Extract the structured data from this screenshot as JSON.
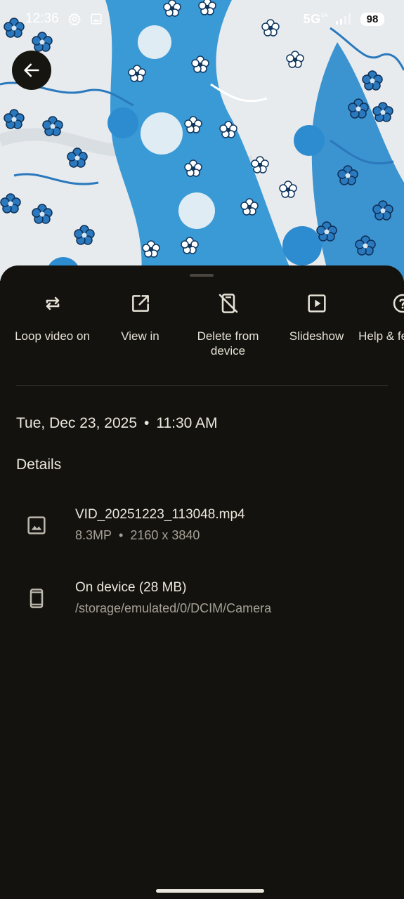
{
  "status_bar": {
    "time": "12:36",
    "network": "5G",
    "network_sup": "SA",
    "battery": "98",
    "icons": [
      "settings-icon",
      "image-notification-icon",
      "signal-icon",
      "battery-icon"
    ]
  },
  "back_button": {
    "icon": "arrow-left-icon"
  },
  "actions": [
    {
      "label": "Loop video on",
      "icon": "repeat-icon"
    },
    {
      "label": "View in",
      "icon": "open-external-icon"
    },
    {
      "label": "Delete from device",
      "icon": "phone-off-icon"
    },
    {
      "label": "Slideshow",
      "icon": "play-square-icon"
    },
    {
      "label": "Help & feedback",
      "icon": "help-icon"
    }
  ],
  "date": {
    "day": "Tue, Dec 23, 2025",
    "time": "11:30 AM"
  },
  "details": {
    "title": "Details",
    "file": {
      "name": "VID_20251223_113048.mp4",
      "megapixels": "8.3MP",
      "resolution": "2160 x 3840",
      "icon": "image-icon"
    },
    "location": {
      "title": "On device (28 MB)",
      "path": "/storage/emulated/0/DCIM/Camera",
      "icon": "smartphone-icon"
    }
  },
  "colors": {
    "background": "#14120e",
    "text": "#ece7dd",
    "text_secondary": "#a6a196",
    "fabric_blue": "#3a9ad6"
  }
}
